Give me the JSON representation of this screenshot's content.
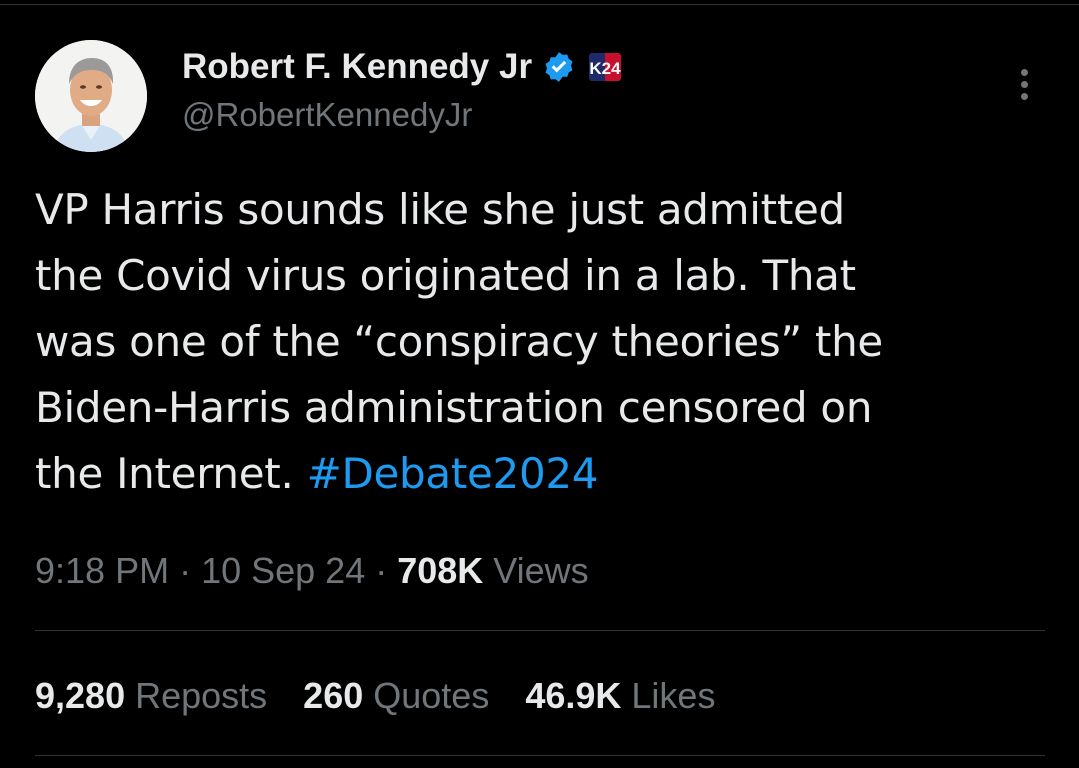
{
  "author": {
    "display_name": "Robert F. Kennedy Jr",
    "handle": "@RobertKennedyJr",
    "verified": true,
    "badge_text": "K24",
    "avatar_icon": "profile-photo"
  },
  "tweet": {
    "text_lines": [
      "VP Harris sounds like she just admitted",
      "the Covid virus originated in a lab. That",
      "was one of the “conspiracy theories” the",
      "Biden-Harris administration censored on"
    ],
    "last_line_prefix": "the Internet. ",
    "hashtag": "#Debate2024"
  },
  "meta": {
    "time": "9:18 PM",
    "separator": " · ",
    "date": "10 Sep 24",
    "views_count": "708K",
    "views_label": " Views"
  },
  "stats": {
    "reposts_count": "9,280",
    "reposts_label": "Reposts",
    "quotes_count": "260",
    "quotes_label": "Quotes",
    "likes_count": "46.9K",
    "likes_label": "Likes"
  },
  "colors": {
    "background": "#000000",
    "text_primary": "#e7e9ea",
    "text_secondary": "#71767b",
    "link_blue": "#1d9bf0",
    "divider": "#2f3336"
  }
}
